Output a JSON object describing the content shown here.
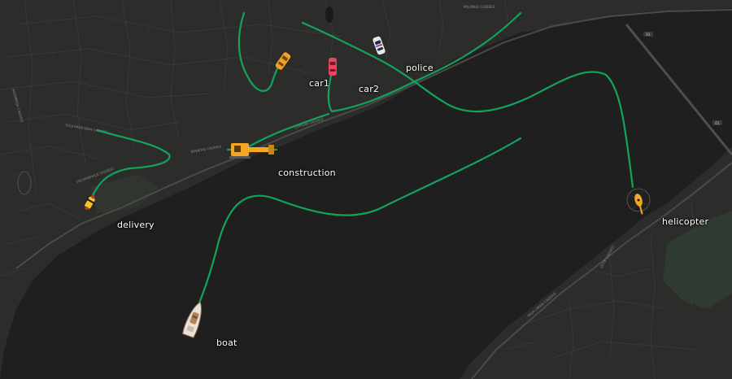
{
  "map": {
    "colors": {
      "land": "#2c2d2b",
      "water": "#1f1f1f",
      "road": "#3e3e3d",
      "major_road": "#4a4a48",
      "park": "#2f3a30",
      "track": "#13a35a",
      "label": "#ffffff"
    },
    "vehicles": [
      {
        "id": "car1",
        "label": "car1",
        "icon": "orange-car-icon"
      },
      {
        "id": "car2",
        "label": "car2",
        "icon": "red-car-icon"
      },
      {
        "id": "police",
        "label": "police",
        "icon": "police-car-icon"
      },
      {
        "id": "construction",
        "label": "construction",
        "icon": "excavator-icon"
      },
      {
        "id": "delivery",
        "label": "delivery",
        "icon": "delivery-scooter-icon"
      },
      {
        "id": "helicopter",
        "label": "helicopter",
        "icon": "helicopter-icon"
      },
      {
        "id": "boat",
        "label": "boat",
        "icon": "boat-icon"
      }
    ],
    "street_labels": [
      "PALANGA CADDESİ",
      "ÇIRAĞAN CADDESİ",
      "BEŞİKTAŞ CADDESİ",
      "SÜLEYMAN SEBA CADDESİ",
      "DOLMABAHÇE CADDESİ",
      "KASIMPAŞA CADDESİ",
      "PAŞA LİMANI CADDESİ",
      "ÇEVİK CADDESİ"
    ],
    "road_shields": [
      "O1",
      "O1"
    ]
  }
}
